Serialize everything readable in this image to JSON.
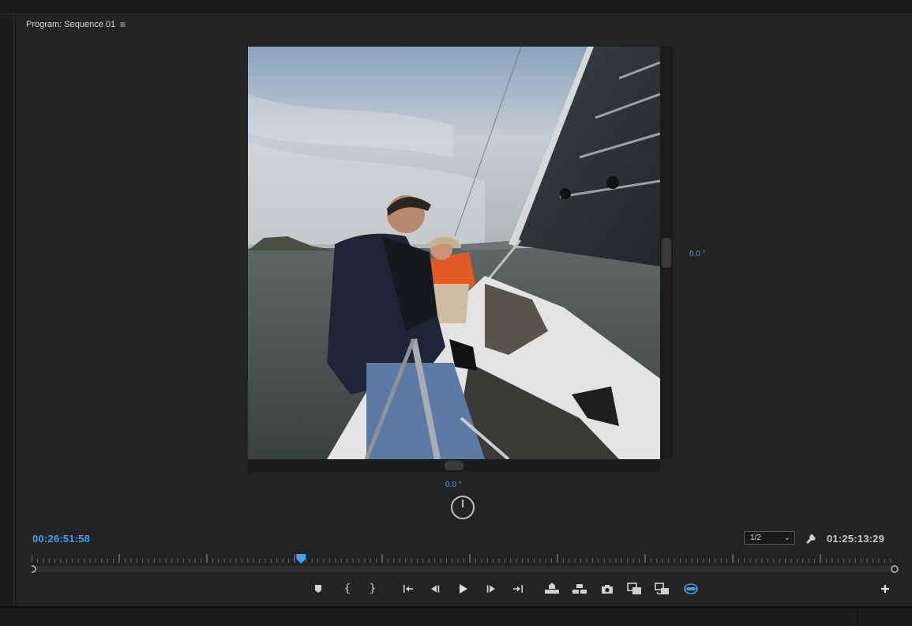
{
  "panel": {
    "title": "Program: Sequence 01",
    "menu_glyph": "≡"
  },
  "viewer": {
    "angle_vertical": "0.0 °",
    "angle_horizontal": "0.0 °"
  },
  "timecode": {
    "current": "00:26:51:58",
    "duration": "01:25:13:29"
  },
  "resolution": {
    "selected": "1/2"
  },
  "playhead": {
    "position_fraction": 0.312
  },
  "transport": {
    "buttons": [
      "add-marker",
      "mark-in",
      "mark-out",
      "go-to-in",
      "step-back",
      "play",
      "step-forward",
      "go-to-out",
      "lift",
      "extract",
      "export-frame",
      "comparison-view",
      "toggle-proxies",
      "toggle-vr-video-display",
      "button-editor"
    ]
  },
  "colors": {
    "accent": "#3ea3f5",
    "panel": "#232323",
    "text": "#d8d8d8"
  }
}
